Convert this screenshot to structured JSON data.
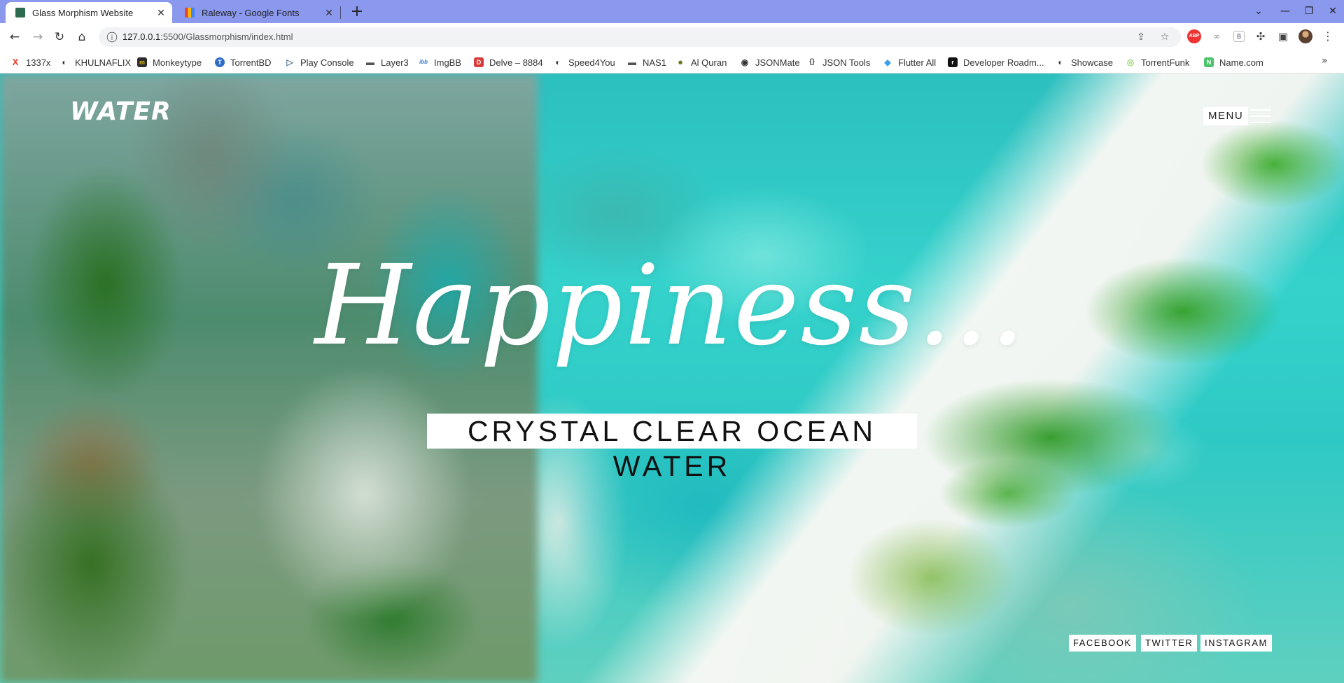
{
  "browser": {
    "tabs": [
      {
        "title": "Glass Morphism Website",
        "close": "✕",
        "active": true
      },
      {
        "title": "Raleway - Google Fonts",
        "close": "✕",
        "active": false
      }
    ],
    "new_tab": "+",
    "window_controls": {
      "list": "⌄",
      "minimize": "—",
      "restore": "❐",
      "close": "✕"
    },
    "nav": {
      "back": "←",
      "forward": "→",
      "reload": "↻",
      "home": "⌂"
    },
    "url": {
      "host": "127.0.0.1",
      "rest": ":5500/Glassmorphism/index.html"
    },
    "omnibox_icons": {
      "share": "⇪",
      "star": "☆"
    },
    "extensions": {
      "abp": "ABP",
      "link": "∞",
      "b": "B",
      "puzzle": "✣",
      "sidepanel": "▣",
      "kebab": "⋮"
    },
    "bookmarks": [
      {
        "label": "1337x",
        "icon": "X",
        "color": "#e8412e"
      },
      {
        "label": "KHULNAFLIX",
        "icon": "◐",
        "color": "#333333"
      },
      {
        "label": "Monkeytype",
        "icon": "m",
        "color": "#2c2c2c"
      },
      {
        "label": "TorrentBD",
        "icon": "T",
        "color": "#2f6cc8"
      },
      {
        "label": "Play Console",
        "icon": "▷",
        "color": "#5b7a9a"
      },
      {
        "label": "Layer3",
        "icon": "▬",
        "color": "#555555"
      },
      {
        "label": "ImgBB",
        "icon": "ibb",
        "color": "#3a78d6"
      },
      {
        "label": "Delve – 8884",
        "icon": "D",
        "color": "#d83b3b"
      },
      {
        "label": "Speed4You",
        "icon": "◐",
        "color": "#333333"
      },
      {
        "label": "NAS1",
        "icon": "▬",
        "color": "#555555"
      },
      {
        "label": "Al Quran",
        "icon": "●",
        "color": "#6b7c2a"
      },
      {
        "label": "JSONMate",
        "icon": "◉",
        "color": "#333333"
      },
      {
        "label": "JSON Tools",
        "icon": "{}",
        "color": "#444444"
      },
      {
        "label": "Flutter All",
        "icon": "◆",
        "color": "#3aa0e8"
      },
      {
        "label": "Developer Roadm...",
        "icon": "r",
        "color": "#111111"
      },
      {
        "label": "Showcase",
        "icon": "◐",
        "color": "#333333"
      },
      {
        "label": "TorrentFunk",
        "icon": "◎",
        "color": "#9bd86b"
      },
      {
        "label": "Name.com",
        "icon": "N",
        "color": "#4bc36b"
      }
    ],
    "bookmarks_more": "»"
  },
  "site": {
    "logo": "WATER",
    "menu_label": "MENU",
    "headline": "Happiness...",
    "subtitle": "CRYSTAL CLEAR OCEAN WATER",
    "social": [
      "FACEBOOK",
      "TWITTER",
      "INSTAGRAM"
    ]
  }
}
